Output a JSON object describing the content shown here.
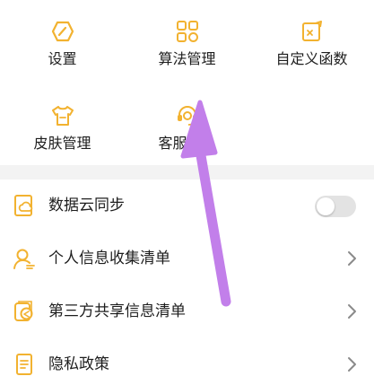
{
  "accent_color": "#F2B230",
  "annotation_color": "#C27FEA",
  "grid": {
    "items": [
      {
        "label": "设置",
        "icon": "gear-hexagon-icon"
      },
      {
        "label": "算法管理",
        "icon": "algorithm-grid-icon"
      },
      {
        "label": "自定义函数",
        "icon": "custom-function-icon"
      },
      {
        "label": "皮肤管理",
        "icon": "shirt-skin-icon"
      },
      {
        "label": "客服中心",
        "icon": "headset-customer-service-icon"
      }
    ]
  },
  "list": {
    "items": [
      {
        "label": "数据云同步",
        "icon": "cloud-sync-icon",
        "control": "toggle",
        "toggle_on": false
      },
      {
        "label": "个人信息收集清单",
        "icon": "person-icon",
        "control": "chevron"
      },
      {
        "label": "第三方共享信息清单",
        "icon": "share-icon",
        "control": "chevron"
      },
      {
        "label": "隐私政策",
        "icon": "policy-document-icon",
        "control": "chevron"
      }
    ]
  }
}
